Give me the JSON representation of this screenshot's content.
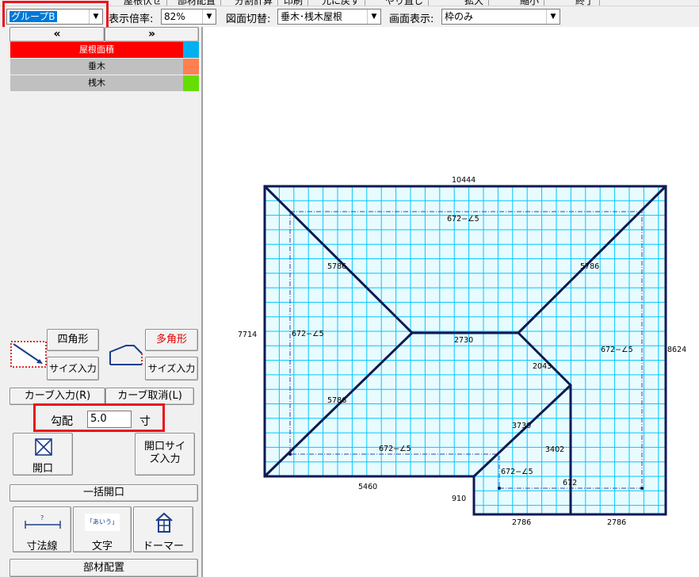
{
  "menubar": {
    "items": [
      "屋根伏せ",
      "部材配置",
      "分割計算",
      "印刷",
      "元に戻す",
      "やり直し",
      "拡大",
      "縮小",
      "終了"
    ]
  },
  "toolbar": {
    "group_value": "グループB",
    "scale_label": "表示倍率:",
    "scale_value": "82%",
    "view_label": "図面切替:",
    "view_value": "垂木･桟木屋根",
    "display_label": "画面表示:",
    "display_value": "枠のみ"
  },
  "panel": {
    "prev_label": "«",
    "next_label": "»",
    "layers": [
      {
        "label": "屋根面積",
        "bg": "#ff0000",
        "fg": "#ffffff",
        "swatch": "#00b0f0"
      },
      {
        "label": "垂木",
        "bg": "#c0c0c0",
        "fg": "#000000",
        "swatch": "#ff7f50"
      },
      {
        "label": "桟木",
        "bg": "#c0c0c0",
        "fg": "#000000",
        "swatch": "#66dd00"
      }
    ],
    "rect_label": "四角形",
    "poly_label": "多角形",
    "size_input_label": "サイズ入力",
    "curve_input_label": "カーブ入力(R)",
    "curve_cancel_label": "カーブ取消(L)",
    "slope_label": "勾配",
    "slope_value": "5.0",
    "slope_unit": "寸",
    "opening_label": "開口",
    "opening_size_label": "開口サイズ入力",
    "bulk_opening_label": "一括開口",
    "dim_line_label": "寸法線",
    "text_label": "文字",
    "text_icon_text": "「あいう」",
    "dormer_label": "ドーマー",
    "parts_label": "部材配置"
  },
  "drawing": {
    "dim_top": "10444",
    "dim_left": "7714",
    "dim_right": "8624",
    "dim_bottom_left": "5460",
    "dim_step_left": "910",
    "dim_bottom_a": "2786",
    "dim_bottom_b": "2786",
    "hip_labels": [
      "5786",
      "5786",
      "5786"
    ],
    "ridge_label": "2730",
    "valley_labels": [
      "2043",
      "3730",
      "3402",
      "672"
    ],
    "eave_labels": [
      "672−∠5",
      "672−∠5",
      "672−∠5",
      "672−∠5",
      "672−∠5"
    ],
    "colors": {
      "outline": "#0d1a55",
      "grid": "#00c8ff",
      "fill": "#e8fbff",
      "eave": "#3344aa"
    }
  }
}
